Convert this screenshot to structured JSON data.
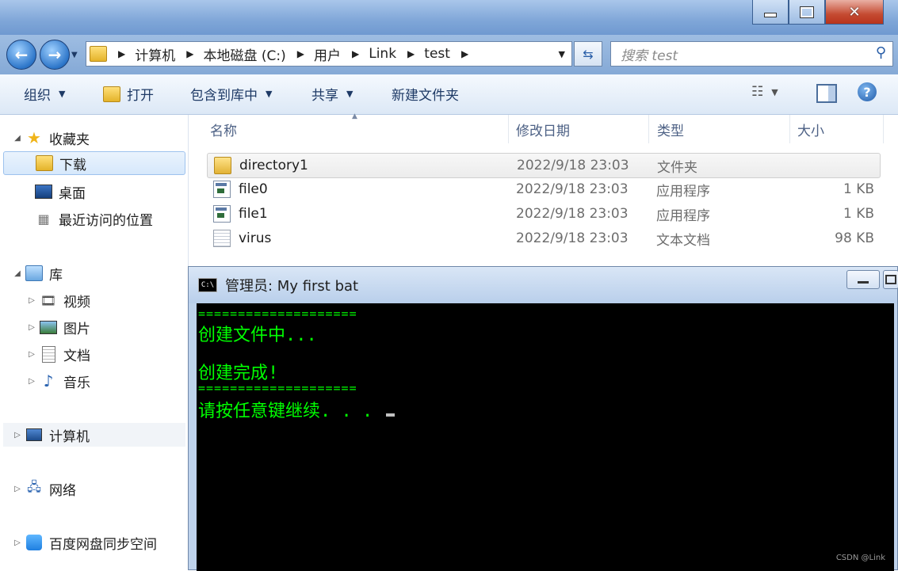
{
  "window": {
    "controls": [
      "minimize",
      "maximize",
      "close"
    ]
  },
  "address": {
    "breadcrumbs": [
      "计算机",
      "本地磁盘 (C:)",
      "用户",
      "Link",
      "test"
    ]
  },
  "search": {
    "placeholder": "搜索 test"
  },
  "toolbar": {
    "organize": "组织",
    "open": "打开",
    "include": "包含到库中",
    "share": "共享",
    "new_folder": "新建文件夹"
  },
  "nav": {
    "favorites": "收藏夹",
    "downloads": "下载",
    "desktop": "桌面",
    "recent": "最近访问的位置",
    "libraries": "库",
    "videos": "视频",
    "pictures": "图片",
    "documents": "文档",
    "music": "音乐",
    "computer": "计算机",
    "network": "网络",
    "baidu": "百度网盘同步空间"
  },
  "columns": {
    "name": "名称",
    "date": "修改日期",
    "type": "类型",
    "size": "大小"
  },
  "files": [
    {
      "name": "directory1",
      "date": "2022/9/18 23:03",
      "type": "文件夹",
      "size": "",
      "icon": "folder-icon"
    },
    {
      "name": "file0",
      "date": "2022/9/18 23:03",
      "type": "应用程序",
      "size": "1 KB",
      "icon": "app-icon"
    },
    {
      "name": "file1",
      "date": "2022/9/18 23:03",
      "type": "应用程序",
      "size": "1 KB",
      "icon": "app-icon"
    },
    {
      "name": "virus",
      "date": "2022/9/18 23:03",
      "type": "文本文档",
      "size": "98 KB",
      "icon": "text-file-icon"
    }
  ],
  "console": {
    "title": "管理员:  My first bat",
    "icon_text": "C:\\",
    "lines": [
      "====================",
      "创建文件中...",
      "创建完成!",
      "====================",
      "请按任意键继续. . . "
    ],
    "text_color": "#00ff00"
  },
  "watermark": "CSDN @Link"
}
